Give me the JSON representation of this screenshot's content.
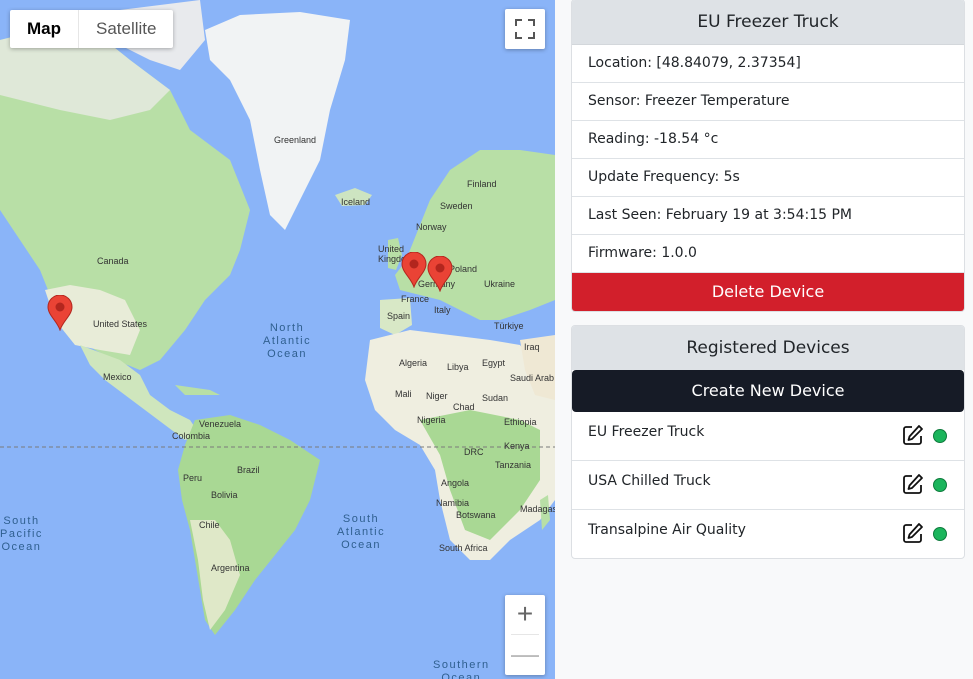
{
  "map": {
    "type_buttons": {
      "map": "Map",
      "satellite": "Satellite"
    },
    "labels": {
      "greenland": "Greenland",
      "iceland": "Iceland",
      "finland": "Finland",
      "sweden": "Sweden",
      "norway": "Norway",
      "uk": "United\nKingdom",
      "poland": "Poland",
      "germany": "Germany",
      "ukraine": "Ukraine",
      "france": "France",
      "spain": "Spain",
      "italy": "Italy",
      "turkiye": "Türkiye",
      "canada": "Canada",
      "us": "United States",
      "mexico": "Mexico",
      "algeria": "Algeria",
      "libya": "Libya",
      "egypt": "Egypt",
      "iraq": "Iraq",
      "saudi": "Saudi Arab",
      "mali": "Mali",
      "niger": "Niger",
      "chad": "Chad",
      "sudan": "Sudan",
      "nigeria": "Nigeria",
      "ethiopia": "Ethiopia",
      "drc": "DRC",
      "kenya": "Kenya",
      "tanzania": "Tanzania",
      "angola": "Angola",
      "namibia": "Namibia",
      "botswana": "Botswana",
      "south_africa": "South Africa",
      "madagascar": "Madagas",
      "venezuela": "Venezuela",
      "colombia": "Colombia",
      "peru": "Peru",
      "brazil": "Brazil",
      "bolivia": "Bolivia",
      "chile": "Chile",
      "argentina": "Argentina",
      "north_atlantic": "North\nAtlantic\nOcean",
      "south_atlantic": "South\nAtlantic\nOcean",
      "south_pacific": "South\nPacific\nOcean",
      "southern": "Southern\nOcean"
    },
    "zoom": {
      "in": "+",
      "out": "—"
    }
  },
  "device": {
    "title": "EU Freezer Truck",
    "location": "Location: [48.84079, 2.37354]",
    "sensor": "Sensor: Freezer Temperature",
    "reading": "Reading: -18.54 °c",
    "frequency": "Update Frequency: 5s",
    "last_seen": "Last Seen: February 19 at 3:54:15 PM",
    "firmware": "Firmware: 1.0.0",
    "delete_label": "Delete Device"
  },
  "registry": {
    "title": "Registered Devices",
    "create_label": "Create New Device",
    "devices": [
      {
        "name": "EU Freezer Truck",
        "status": "online",
        "status_color": "#1bb55c"
      },
      {
        "name": "USA Chilled Truck",
        "status": "online",
        "status_color": "#1bb55c"
      },
      {
        "name": "Transalpine Air Quality",
        "status": "online",
        "status_color": "#1bb55c"
      }
    ]
  },
  "colors": {
    "delete": "#d21f2b",
    "create": "#161b26",
    "ocean": "#8ab4f8",
    "land": "#b7dfa5",
    "marker": "#ea4335"
  }
}
